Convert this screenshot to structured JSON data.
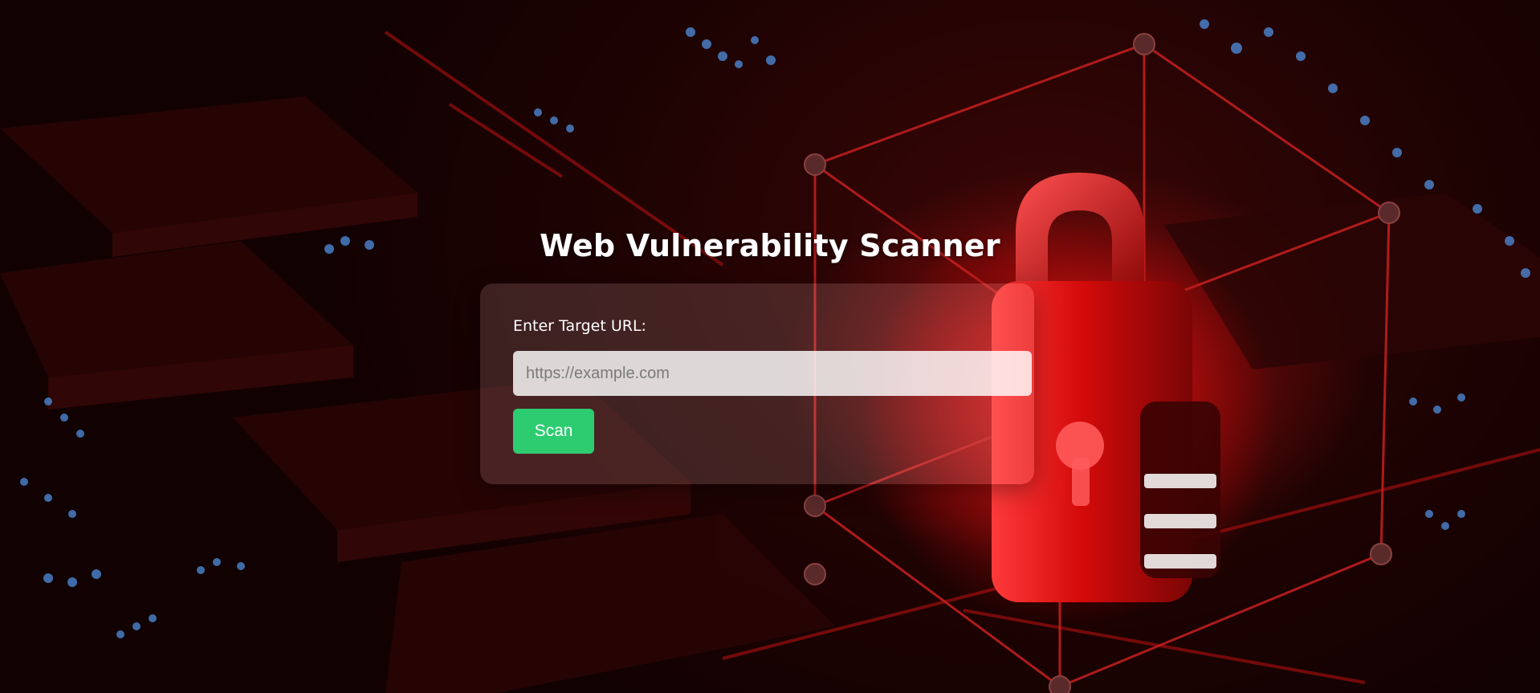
{
  "page": {
    "title": "Web Vulnerability Scanner"
  },
  "form": {
    "label": "Enter Target URL:",
    "input_value": "",
    "input_placeholder": "https://example.com",
    "submit_label": "Scan"
  },
  "background": {
    "image_subject": "red-padlock-in-wireframe-cube-on-circuit-board",
    "icon": "padlock-icon"
  },
  "colors": {
    "scan_button": "#2ecc71",
    "accent_red": "#e01010",
    "background_dark": "#140202",
    "text": "#ffffff"
  }
}
